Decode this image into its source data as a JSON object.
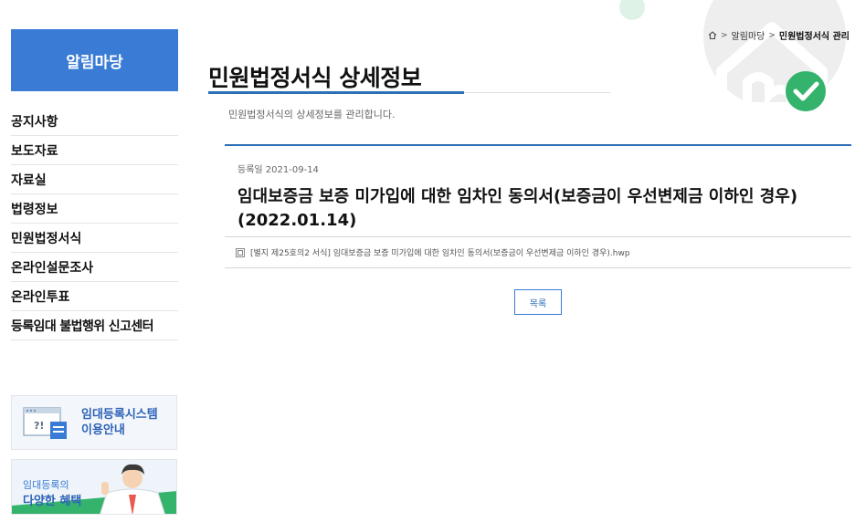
{
  "sidebar": {
    "heading": "알림마당",
    "items": [
      {
        "label": "공지사항"
      },
      {
        "label": "보도자료"
      },
      {
        "label": "자료실"
      },
      {
        "label": "법령정보"
      },
      {
        "label": "민원법정서식"
      },
      {
        "label": "온라인설문조사"
      },
      {
        "label": "온라인투표"
      },
      {
        "label": "등록임대 불법행위 신고센터"
      }
    ],
    "banners": {
      "system_line1": "임대등록시스템",
      "system_line2": "이용안내",
      "benefit_line1": "임대등록의",
      "benefit_line2": "다양한 혜택"
    }
  },
  "breadcrumb": {
    "home_icon": "home-icon",
    "items": [
      "알림마당",
      "민원법정서식 관리"
    ]
  },
  "page": {
    "title": "민원법정서식 상세정보",
    "description": "민원법정서식의 상세정보를 관리합니다."
  },
  "detail": {
    "date_label": "등록일",
    "date_value": "2021-09-14",
    "title": "임대보증금 보증 미가입에 대한 임차인 동의서(보증금이 우선변제금 이하인 경우)(2022.01.14)",
    "file_icon": "file-icon",
    "file_name": "[별지 제25호의2 서식] 임대보증금 보증 미가입에 대한 임차인 동의서(보증금이 우선변제금 이하인 경우).hwp",
    "list_button": "목록"
  },
  "colors": {
    "primary": "#3a7bd5",
    "accent_line": "#2c6fb7",
    "check_green": "#33b36b"
  }
}
